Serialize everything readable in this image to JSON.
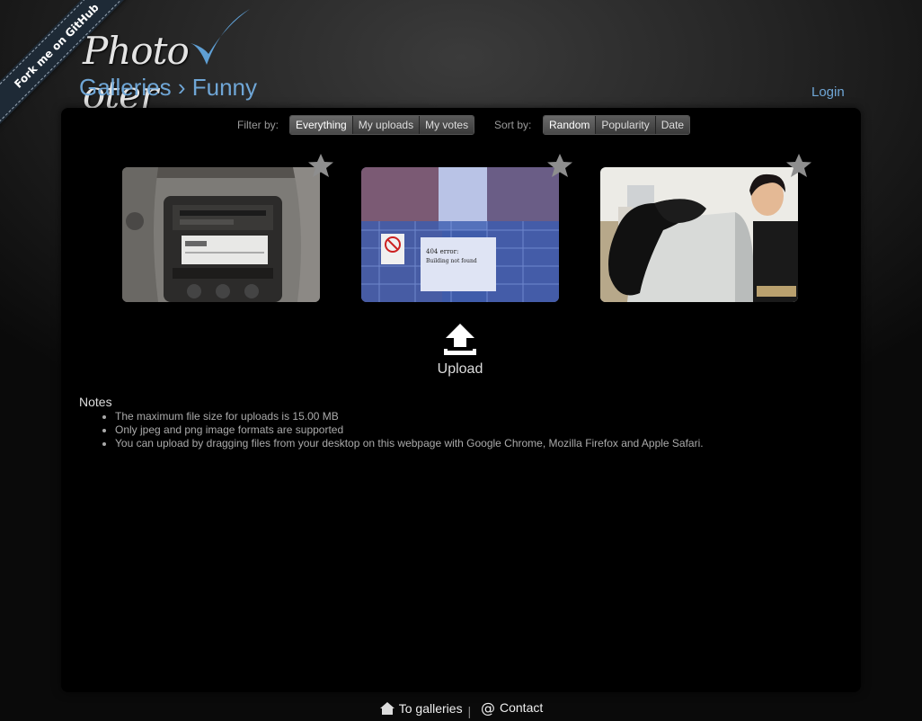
{
  "ribbon": {
    "label": "Fork me on GitHub"
  },
  "logo": {
    "text": "Photo oter"
  },
  "breadcrumb": {
    "root": "Galleries",
    "separator": "›",
    "current": "Funny"
  },
  "header": {
    "login_label": "Login"
  },
  "filter": {
    "label": "Filter by:",
    "options": [
      "Everything",
      "My uploads",
      "My votes"
    ],
    "selected": "Everything"
  },
  "sort": {
    "label": "Sort by:",
    "options": [
      "Random",
      "Popularity",
      "Date"
    ],
    "selected": "Random"
  },
  "photos": [
    {
      "subject": "car stereo dashboard",
      "starred": false
    },
    {
      "subject": "404 error construction site",
      "caption": "404 error:\nBuilding not found",
      "starred": false
    },
    {
      "subject": "man behind monitor with socks",
      "starred": false
    }
  ],
  "upload": {
    "label": "Upload",
    "icon": "upload-icon"
  },
  "notes": {
    "title": "Notes",
    "items": [
      "The maximum file size for uploads is 15.00 MB",
      "Only jpeg and png image formats are supported",
      "You can upload by dragging files from your desktop on this webpage with Google Chrome, Mozilla Firefox and Apple Safari."
    ]
  },
  "footer": {
    "galleries_label": "To galleries",
    "separator": "|",
    "contact_label": "Contact"
  },
  "colors": {
    "link": "#6fa6d6",
    "panel": "#000000",
    "background": "#262626"
  }
}
